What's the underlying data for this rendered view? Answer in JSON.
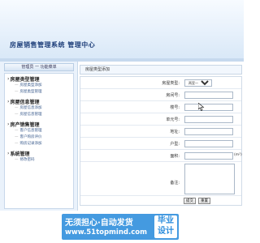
{
  "header": {
    "title": "房屋销售管理系统  管理中心"
  },
  "sidebar": {
    "heading": "管理员  一 功能菜单",
    "groups": [
      {
        "title": "房屋类型管理",
        "items": [
          "房屋类型添加",
          "房屋类型管理"
        ]
      },
      {
        "title": "房屋信息管理",
        "items": [
          "房屋信息添加",
          "房屋信息管理"
        ]
      },
      {
        "title": "房产销售管理",
        "items": [
          "客户信息管理",
          "客户购房评价",
          "购房记录添加"
        ]
      },
      {
        "title": "系统管理",
        "items": [
          "修改密码"
        ]
      }
    ]
  },
  "form": {
    "heading": "房屋类型添加",
    "fields": {
      "type": {
        "label": "房屋类型:",
        "value": "两室一厅"
      },
      "house_no": {
        "label": "房间号:",
        "value": ""
      },
      "building": {
        "label": "楼号:",
        "value": ""
      },
      "unit": {
        "label": "单元号:",
        "value": ""
      },
      "address": {
        "label": "地址:",
        "value": ""
      },
      "orientation": {
        "label": "户型:",
        "value": ""
      },
      "area": {
        "label": "面积:",
        "value": "",
        "unit": "(m²)"
      },
      "note": {
        "label": "备注:",
        "value": ""
      }
    },
    "submit_label": "提交",
    "reset_label": "重置"
  },
  "watermark": {
    "line1": "无须担心·自动发货",
    "line2": "www.51topmind.com",
    "badge_top": "毕业",
    "badge_bottom": "设计"
  }
}
